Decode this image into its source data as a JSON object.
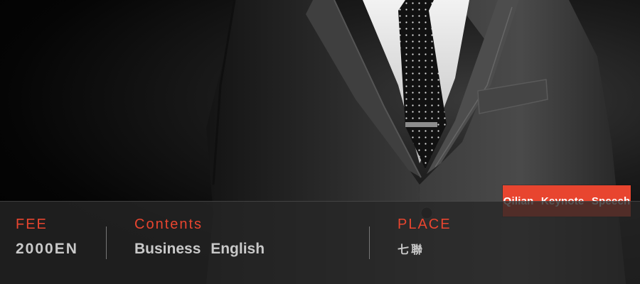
{
  "banner": {
    "tag_label": "Qilian Keynote Speech"
  },
  "info": {
    "fee_label": "FEE",
    "fee_value": "2000EN",
    "contents_label": "Contents",
    "contents_value": "Business English",
    "place_label": "PLACE",
    "place_value": "七聯"
  },
  "colors": {
    "accent": "#e8452f",
    "value_text": "#c9c9c9",
    "bar_background": "#262626"
  },
  "icons": []
}
